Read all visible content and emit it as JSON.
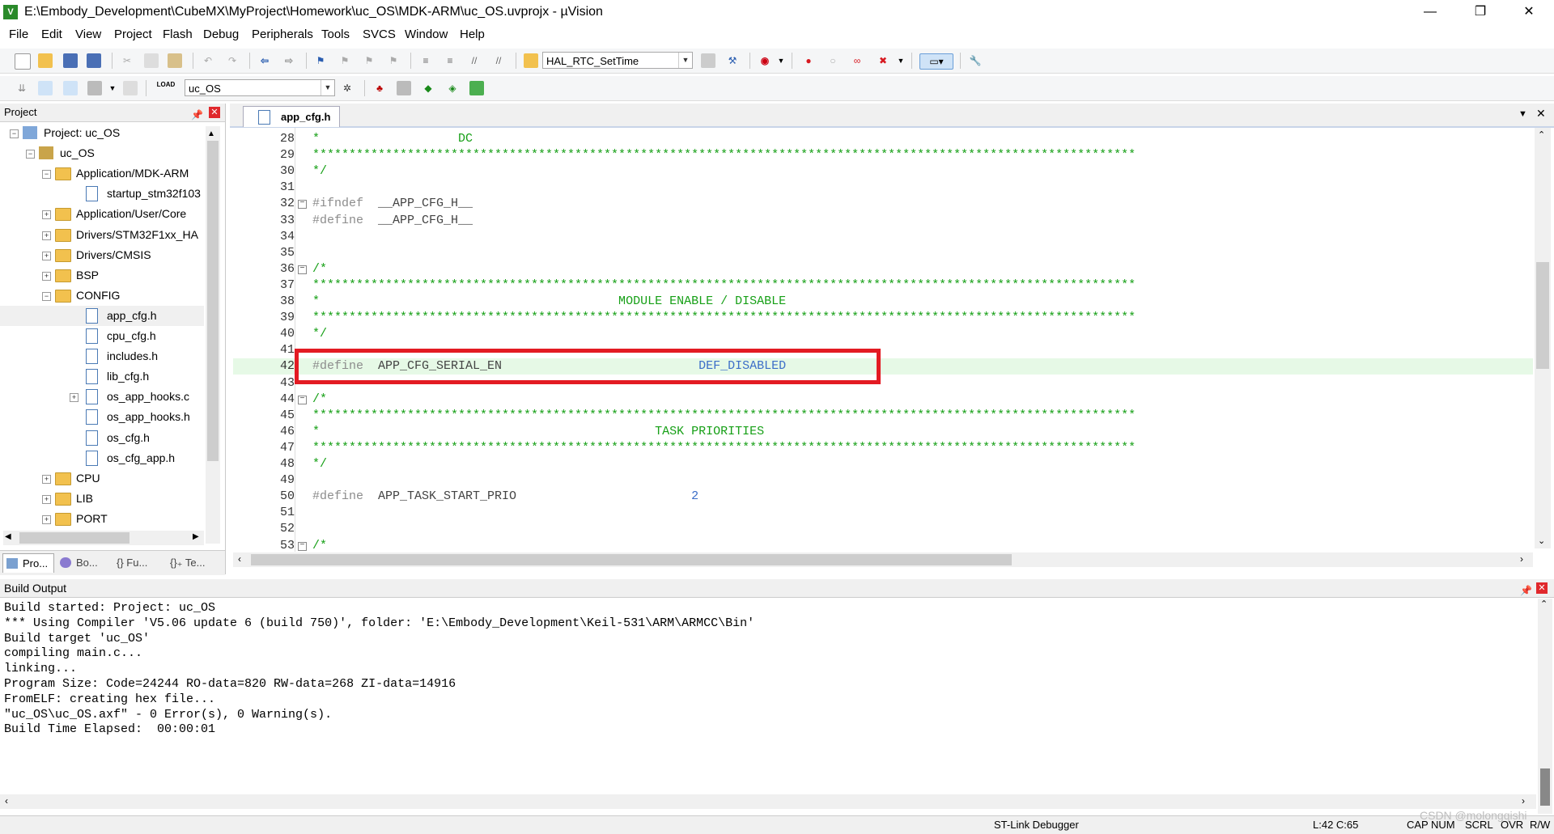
{
  "window": {
    "title": "E:\\Embody_Development\\CubeMX\\MyProject\\Homework\\uc_OS\\MDK-ARM\\uc_OS.uvprojx - µVision",
    "minimize_label": "—",
    "maximize_label": "❐",
    "close_label": "✕"
  },
  "menu": [
    {
      "label": "File"
    },
    {
      "label": "Edit"
    },
    {
      "label": "View"
    },
    {
      "label": "Project"
    },
    {
      "label": "Flash"
    },
    {
      "label": "Debug"
    },
    {
      "label": "Peripherals"
    },
    {
      "label": "Tools"
    },
    {
      "label": "SVCS"
    },
    {
      "label": "Window"
    },
    {
      "label": "Help"
    }
  ],
  "toolbar1": {
    "function_combo": "HAL_RTC_SetTime"
  },
  "toolbar2": {
    "load_label": "LOAD",
    "target_combo": "uc_OS"
  },
  "project_panel": {
    "title": "Project",
    "tree": [
      {
        "label": "Project: uc_OS",
        "type": "project",
        "level": 0,
        "expander": "−"
      },
      {
        "label": "uc_OS",
        "type": "target",
        "level": 1,
        "expander": "−"
      },
      {
        "label": "Application/MDK-ARM",
        "type": "folder",
        "level": 2,
        "expander": "−"
      },
      {
        "label": "startup_stm32f103",
        "type": "file",
        "level": 3,
        "expander": ""
      },
      {
        "label": "Application/User/Core",
        "type": "folder",
        "level": 2,
        "expander": "+"
      },
      {
        "label": "Drivers/STM32F1xx_HA",
        "type": "folder",
        "level": 2,
        "expander": "+"
      },
      {
        "label": "Drivers/CMSIS",
        "type": "folder",
        "level": 2,
        "expander": "+"
      },
      {
        "label": "BSP",
        "type": "folder",
        "level": 2,
        "expander": "+"
      },
      {
        "label": "CONFIG",
        "type": "folder",
        "level": 2,
        "expander": "−"
      },
      {
        "label": "app_cfg.h",
        "type": "file",
        "level": 3,
        "expander": "",
        "selected": true
      },
      {
        "label": "cpu_cfg.h",
        "type": "file",
        "level": 3,
        "expander": ""
      },
      {
        "label": "includes.h",
        "type": "file",
        "level": 3,
        "expander": ""
      },
      {
        "label": "lib_cfg.h",
        "type": "file",
        "level": 3,
        "expander": ""
      },
      {
        "label": "os_app_hooks.c",
        "type": "file",
        "level": 3,
        "expander": "+"
      },
      {
        "label": "os_app_hooks.h",
        "type": "file",
        "level": 3,
        "expander": ""
      },
      {
        "label": "os_cfg.h",
        "type": "file",
        "level": 3,
        "expander": ""
      },
      {
        "label": "os_cfg_app.h",
        "type": "file",
        "level": 3,
        "expander": ""
      },
      {
        "label": "CPU",
        "type": "folder",
        "level": 2,
        "expander": "+"
      },
      {
        "label": "LIB",
        "type": "folder",
        "level": 2,
        "expander": "+"
      },
      {
        "label": "PORT",
        "type": "folder",
        "level": 2,
        "expander": "+"
      }
    ],
    "tabs": [
      {
        "label": "Pro..."
      },
      {
        "label": "Bo..."
      },
      {
        "label": "{} Fu..."
      },
      {
        "label": "{}₊ Te..."
      }
    ]
  },
  "editor": {
    "tab_label": "app_cfg.h",
    "lines": [
      {
        "num": "28",
        "fold": "",
        "parts": [
          {
            "cls": "c-comment",
            "text": "*                   DC"
          }
        ]
      },
      {
        "num": "29",
        "fold": "",
        "parts": [
          {
            "cls": "c-comment",
            "text": "*****************************************************************************************************************"
          }
        ]
      },
      {
        "num": "30",
        "fold": "",
        "parts": [
          {
            "cls": "c-comment",
            "text": "*/"
          }
        ]
      },
      {
        "num": "31",
        "fold": "",
        "parts": []
      },
      {
        "num": "32",
        "fold": "−",
        "parts": [
          {
            "cls": "c-pre",
            "text": "#ifndef"
          },
          {
            "cls": "c-id",
            "text": "  __APP_CFG_H__"
          }
        ]
      },
      {
        "num": "33",
        "fold": "",
        "parts": [
          {
            "cls": "c-pre",
            "text": "#define"
          },
          {
            "cls": "c-id",
            "text": "  __APP_CFG_H__"
          }
        ]
      },
      {
        "num": "34",
        "fold": "",
        "parts": []
      },
      {
        "num": "35",
        "fold": "",
        "parts": []
      },
      {
        "num": "36",
        "fold": "−",
        "parts": [
          {
            "cls": "c-comment",
            "text": "/*"
          }
        ]
      },
      {
        "num": "37",
        "fold": "",
        "parts": [
          {
            "cls": "c-comment",
            "text": "*****************************************************************************************************************"
          }
        ]
      },
      {
        "num": "38",
        "fold": "",
        "parts": [
          {
            "cls": "c-comment",
            "text": "*                                         MODULE ENABLE / DISABLE"
          }
        ]
      },
      {
        "num": "39",
        "fold": "",
        "parts": [
          {
            "cls": "c-comment",
            "text": "*****************************************************************************************************************"
          }
        ]
      },
      {
        "num": "40",
        "fold": "",
        "parts": [
          {
            "cls": "c-comment",
            "text": "*/"
          }
        ]
      },
      {
        "num": "41",
        "fold": "",
        "parts": []
      },
      {
        "num": "42",
        "fold": "",
        "highlight": true,
        "parts": [
          {
            "cls": "c-pre",
            "text": "#define"
          },
          {
            "cls": "c-id",
            "text": "  APP_CFG_SERIAL_EN                           "
          },
          {
            "cls": "c-num",
            "text": "DEF_DISABLED"
          }
        ]
      },
      {
        "num": "43",
        "fold": "",
        "parts": []
      },
      {
        "num": "44",
        "fold": "−",
        "parts": [
          {
            "cls": "c-comment",
            "text": "/*"
          }
        ]
      },
      {
        "num": "45",
        "fold": "",
        "parts": [
          {
            "cls": "c-comment",
            "text": "*****************************************************************************************************************"
          }
        ]
      },
      {
        "num": "46",
        "fold": "",
        "parts": [
          {
            "cls": "c-comment",
            "text": "*                                              TASK PRIORITIES"
          }
        ]
      },
      {
        "num": "47",
        "fold": "",
        "parts": [
          {
            "cls": "c-comment",
            "text": "*****************************************************************************************************************"
          }
        ]
      },
      {
        "num": "48",
        "fold": "",
        "parts": [
          {
            "cls": "c-comment",
            "text": "*/"
          }
        ]
      },
      {
        "num": "49",
        "fold": "",
        "parts": []
      },
      {
        "num": "50",
        "fold": "",
        "parts": [
          {
            "cls": "c-pre",
            "text": "#define"
          },
          {
            "cls": "c-id",
            "text": "  APP_TASK_START_PRIO                        "
          },
          {
            "cls": "c-num",
            "text": "2"
          }
        ]
      },
      {
        "num": "51",
        "fold": "",
        "parts": []
      },
      {
        "num": "52",
        "fold": "",
        "parts": []
      },
      {
        "num": "53",
        "fold": "−",
        "parts": [
          {
            "cls": "c-comment",
            "text": "/*"
          }
        ]
      }
    ]
  },
  "build_output": {
    "title": "Build Output",
    "lines": [
      "Build started: Project: uc_OS",
      "*** Using Compiler 'V5.06 update 6 (build 750)', folder: 'E:\\Embody_Development\\Keil-531\\ARM\\ARMCC\\Bin'",
      "Build target 'uc_OS'",
      "compiling main.c...",
      "linking...",
      "Program Size: Code=24244 RO-data=820 RW-data=268 ZI-data=14916",
      "FromELF: creating hex file...",
      "\"uc_OS\\uc_OS.axf\" - 0 Error(s), 0 Warning(s).",
      "Build Time Elapsed:  00:00:01"
    ]
  },
  "status": {
    "debugger": "ST-Link Debugger",
    "position": "L:42 C:65",
    "cap": "CAP",
    "num": "NUM",
    "scrl": "SCRL",
    "ovr": "OVR",
    "rw": "R/W"
  },
  "watermark": "CSDN @molongqishi",
  "colors": {
    "comment": "#17a017",
    "preprocessor": "#8c8c8c",
    "number": "#3c6ec8",
    "highlight_box": "#e31b23",
    "current_line": "#e6f9e6"
  }
}
